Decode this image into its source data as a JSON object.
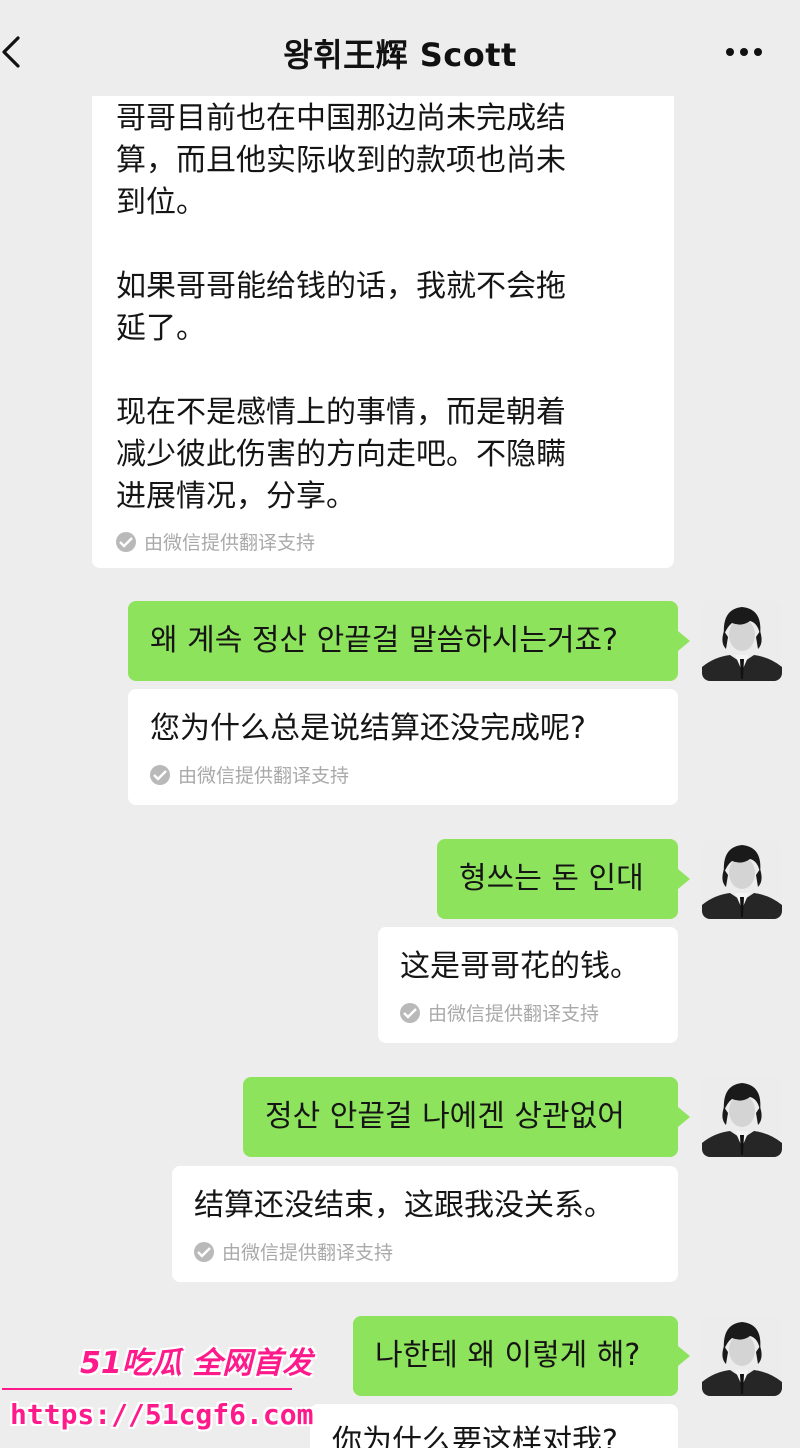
{
  "header": {
    "title": "왕휘王辉 Scott",
    "back_icon": "chevron-left-icon",
    "more_icon": "more-dots-icon"
  },
  "translation_note": "由微信提供翻译支持",
  "messages": [
    {
      "direction": "incoming",
      "text": "哥哥目前也在中国那边尚未完成结\n算，而且他实际收到的款项也尚未\n到位。\n\n如果哥哥能给钱的话，我就不会拖\n延了。\n\n现在不是感情上的事情，而是朝着\n减少彼此伤害的方向走吧。不隐瞒\n进展情况，分享。"
    },
    {
      "direction": "outgoing",
      "text": "왜 계속 정산  안끝걸 말씀하시는거죠?",
      "translation": "您为什么总是说结算还没完成呢?"
    },
    {
      "direction": "outgoing",
      "text": "형쓰는 돈 인대",
      "translation": "这是哥哥花的钱。"
    },
    {
      "direction": "outgoing",
      "text": "정산 안끝걸  나에겐 상관없어",
      "translation": "结算还没结束，这跟我没关系。"
    },
    {
      "direction": "outgoing",
      "text": "나한테 왜 이렇게 해?",
      "translation": "你为什么要这样对我?"
    }
  ],
  "watermark": {
    "brand": "51吃瓜 全网首发",
    "url": "https://51cgf6.com"
  },
  "colors": {
    "background": "#ededed",
    "sent_bubble": "#8ee35c",
    "received_bubble": "#ffffff",
    "watermark": "#ff1a8c"
  }
}
